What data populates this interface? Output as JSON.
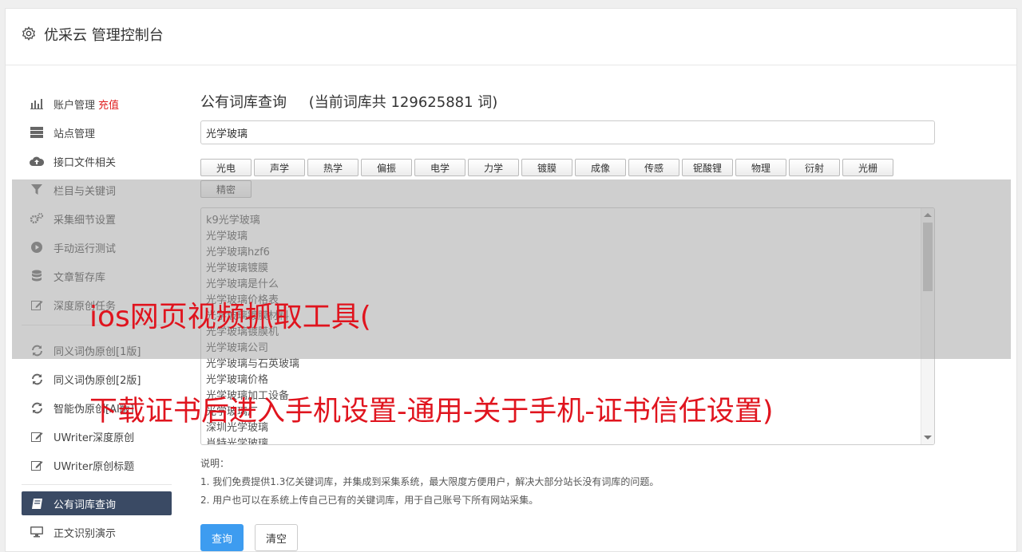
{
  "header": {
    "title": "优采云 管理控制台",
    "icon": "gear-icon"
  },
  "sidebar": {
    "items": [
      {
        "label": "账户管理",
        "badge": "充值",
        "icon": "bar-chart-icon"
      },
      {
        "label": "站点管理",
        "icon": "server-icon"
      },
      {
        "label": "接口文件相关",
        "icon": "cloud-upload-icon"
      },
      {
        "label": "栏目与关键词",
        "icon": "filter-icon"
      },
      {
        "label": "采集细节设置",
        "icon": "gears-icon"
      },
      {
        "label": "手动运行测试",
        "icon": "play-icon"
      },
      {
        "label": "文章暂存库",
        "icon": "database-icon"
      },
      {
        "label": "深度原创任务",
        "icon": "edit-icon"
      },
      {
        "label": "同义词伪原创[1版]",
        "icon": "refresh-icon"
      },
      {
        "label": "同义词伪原创[2版]",
        "icon": "refresh-icon"
      },
      {
        "label": "智能伪原创[AI版]",
        "icon": "refresh-icon"
      },
      {
        "label": "UWriter深度原创",
        "icon": "edit-icon"
      },
      {
        "label": "UWriter原创标题",
        "icon": "edit-icon"
      },
      {
        "label": "公有词库查询",
        "icon": "book-icon",
        "active": true
      },
      {
        "label": "正文识别演示",
        "icon": "monitor-icon"
      }
    ]
  },
  "main": {
    "title": "公有词库查询",
    "count_text": "(当前词库共 129625881 词)",
    "search_value": "光学玻璃",
    "tags": [
      "光电",
      "声学",
      "热学",
      "偏振",
      "电学",
      "力学",
      "镀膜",
      "成像",
      "传感",
      "铌酸锂",
      "物理",
      "衍射",
      "光栅",
      "精密"
    ],
    "results": [
      "k9光学玻璃",
      "光学玻璃",
      "光学玻璃hzf6",
      "光学玻璃镀膜",
      "光学玻璃是什么",
      "光学玻璃价格表",
      "光学玻璃镀膜材料",
      "光学玻璃镀膜机",
      "光学玻璃公司",
      "光学玻璃与石英玻璃",
      "光学玻璃价格",
      "光学玻璃加工设备",
      "光学玻璃厂",
      "深圳光学玻璃",
      "肖特光学玻璃"
    ],
    "note_label": "说明：",
    "notes": [
      "1. 我们免费提供1.3亿关键词库，并集成到采集系统，最大限度方便用户，解决大部分站长没有词库的问题。",
      "2. 用户也可以在系统上传自己已有的关键词库，用于自己账号下所有网站采集。"
    ],
    "query_button": "查询",
    "clear_button": "清空"
  },
  "overlay": {
    "line1": "ios网页视频抓取工具(",
    "line2": "下载证书后进入手机设置-通用-关于手机-证书信任设置)"
  },
  "colors": {
    "accent": "#3d9cf0",
    "active_nav": "#3a4a64",
    "red": "#e02020"
  }
}
